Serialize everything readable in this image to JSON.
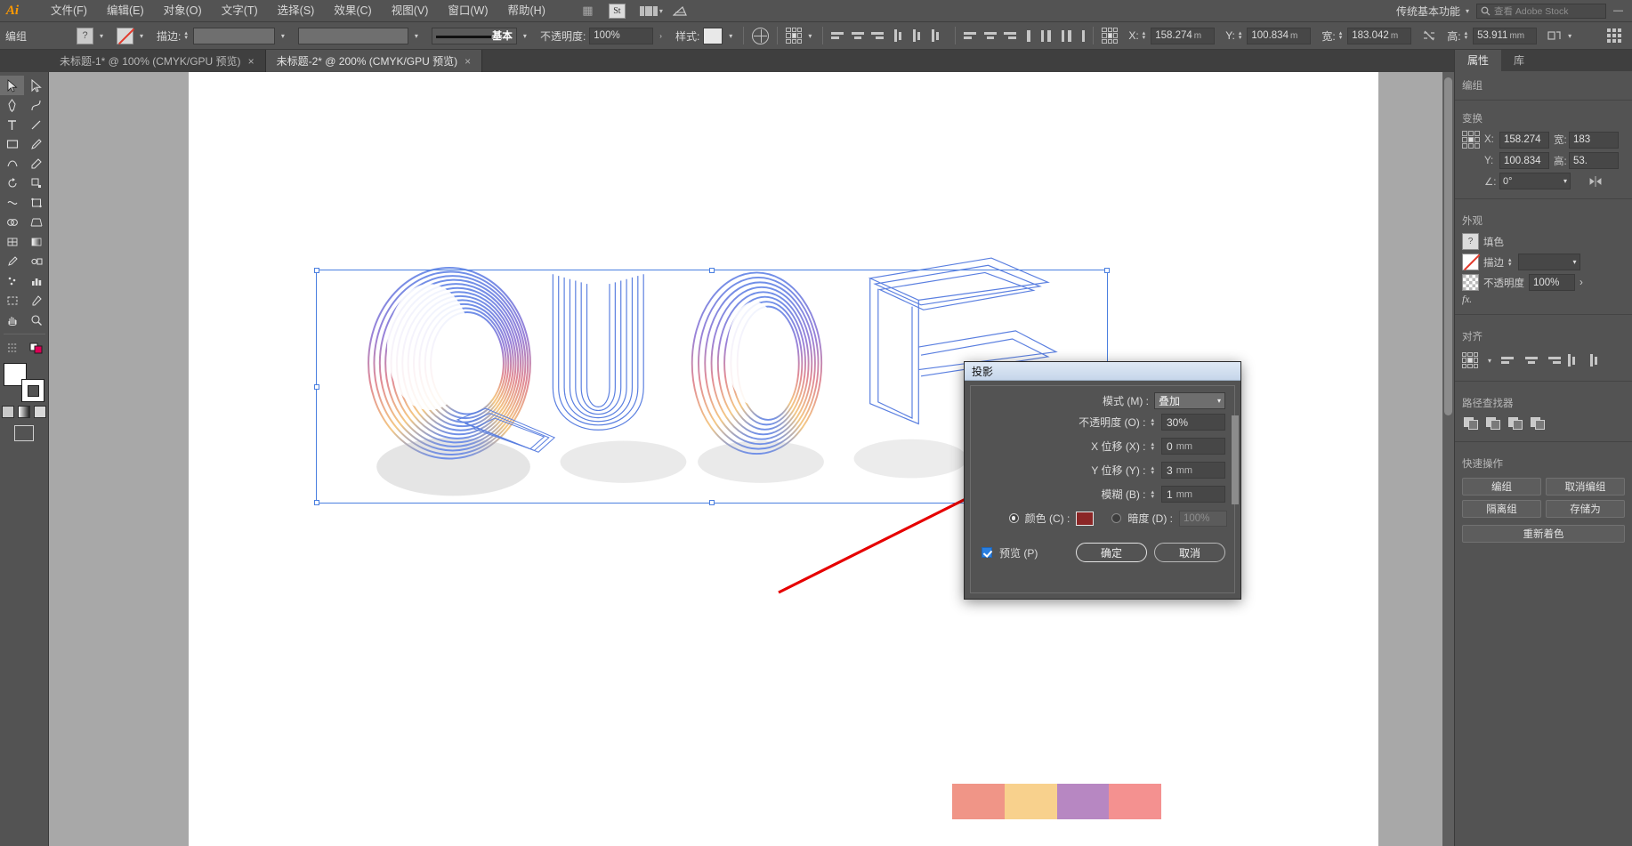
{
  "app": {
    "name": "Adobe Illustrator",
    "logo": "Ai"
  },
  "menubar": {
    "items": [
      "文件(F)",
      "编辑(E)",
      "对象(O)",
      "文字(T)",
      "选择(S)",
      "效果(C)",
      "视图(V)",
      "窗口(W)",
      "帮助(H)"
    ],
    "stock_badge": "St",
    "workspace": "传统基本功能",
    "search_placeholder": "查看 Adobe Stock"
  },
  "control_bar": {
    "selection_label": "编组",
    "fill_swatch": "?",
    "stroke_swatch": "none-swatch",
    "stroke_label": "描边:",
    "stroke_weight": "",
    "stroke_profile_label": "基本",
    "opacity_label": "不透明度:",
    "opacity_value": "100%",
    "style_label": "样式:",
    "x_label": "X:",
    "x_value": "158.274",
    "x_unit": "m",
    "y_label": "Y:",
    "y_value": "100.834",
    "y_unit": "m",
    "w_label": "宽:",
    "w_value": "183.042",
    "w_unit": "m",
    "h_label": "高:",
    "h_value": "53.911",
    "h_unit": "mm"
  },
  "tabs": [
    {
      "label": "未标题-1* @ 100% (CMYK/GPU 预览)",
      "active": false
    },
    {
      "label": "未标题-2* @ 200% (CMYK/GPU 预览)",
      "active": true
    }
  ],
  "properties_panel": {
    "tabs": [
      {
        "label": "属性",
        "active": true
      },
      {
        "label": "库",
        "active": false
      }
    ],
    "selection_type": "编组",
    "transform": {
      "title": "变换",
      "x_label": "X:",
      "x_value": "158.274",
      "y_label": "Y:",
      "y_value": "100.834",
      "w_label": "宽:",
      "w_value": "183",
      "h_label": "高:",
      "h_value": "53.",
      "angle_label": "∠:",
      "angle_value": "0°"
    },
    "appearance": {
      "title": "外观",
      "fill_label": "填色",
      "stroke_label": "描边",
      "opacity_label": "不透明度",
      "opacity_value": "100%",
      "fx_label": "fx."
    },
    "align": {
      "title": "对齐"
    },
    "pathfinder": {
      "title": "路径查找器"
    },
    "quick_actions": {
      "title": "快速操作",
      "buttons": [
        "编组",
        "取消编组",
        "隔离组",
        "存储为",
        "重新着色"
      ]
    }
  },
  "dialog": {
    "title": "投影",
    "mode_label": "模式 (M) :",
    "mode_value": "叠加",
    "opacity_label": "不透明度 (O) :",
    "opacity_value": "30%",
    "xoffset_label": "X 位移 (X) :",
    "xoffset_value": "0",
    "xoffset_unit": "mm",
    "yoffset_label": "Y 位移 (Y) :",
    "yoffset_value": "3",
    "yoffset_unit": "mm",
    "blur_label": "模糊 (B) :",
    "blur_value": "1",
    "blur_unit": "mm",
    "color_label": "颜色 (C) :",
    "color_value": "#8b2626",
    "color_selected": true,
    "darkness_label": "暗度 (D) :",
    "darkness_value": "100%",
    "darkness_selected": false,
    "preview_label": "预览 (P)",
    "preview_checked": true,
    "ok_label": "确定",
    "cancel_label": "取消"
  },
  "canvas": {
    "artwork_text": "QUOE",
    "palette_colors": [
      "#f09587",
      "#f8d18d",
      "#b787c2",
      "#f49190"
    ]
  }
}
